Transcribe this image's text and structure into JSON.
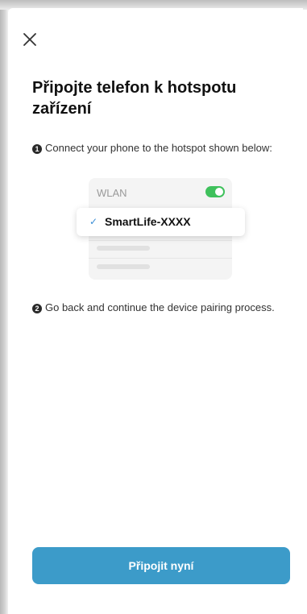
{
  "header": {
    "close_icon": "close-icon"
  },
  "content": {
    "title_line1": "Připojte telefon k hotspotu",
    "title_line2": "zařízení",
    "step1_number": "1",
    "step1_text": "Connect your phone to the hotspot shown below:",
    "step2_number": "2",
    "step2_text": "Go back and continue the device pairing process."
  },
  "illustration": {
    "wlan_label": "WLAN",
    "wlan_enabled": true,
    "toggle_color": "#3fc15c",
    "check_icon": "checkmark-icon",
    "ssid": "SmartLife-XXXX"
  },
  "action": {
    "connect_label": "Připojit nyní",
    "color": "#3c9bc9"
  }
}
